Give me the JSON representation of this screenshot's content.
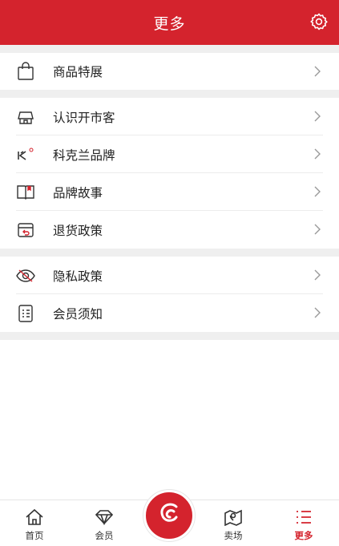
{
  "header": {
    "title": "更多",
    "settings_icon": "gear-icon"
  },
  "colors": {
    "brand": "#d4232d",
    "gap": "#efefef"
  },
  "groups": [
    {
      "items": [
        {
          "label": "商品特展",
          "icon": "shopping-bag-icon"
        }
      ]
    },
    {
      "items": [
        {
          "label": "认识开市客",
          "icon": "store-icon"
        },
        {
          "label": "科克兰品牌",
          "icon": "kirkland-logo-icon"
        },
        {
          "label": "品牌故事",
          "icon": "book-icon"
        },
        {
          "label": "退货政策",
          "icon": "return-box-icon"
        }
      ]
    },
    {
      "items": [
        {
          "label": "隐私政策",
          "icon": "eye-off-icon"
        },
        {
          "label": "会员须知",
          "icon": "checklist-icon"
        }
      ]
    }
  ],
  "tabbar": {
    "tabs": [
      {
        "label": "首页",
        "icon": "home-icon"
      },
      {
        "label": "会员",
        "icon": "diamond-icon"
      },
      {
        "label": "卖场",
        "icon": "map-pin-icon"
      },
      {
        "label": "更多",
        "icon": "list-icon",
        "active": true
      }
    ],
    "center_icon": "costco-logo-icon"
  }
}
